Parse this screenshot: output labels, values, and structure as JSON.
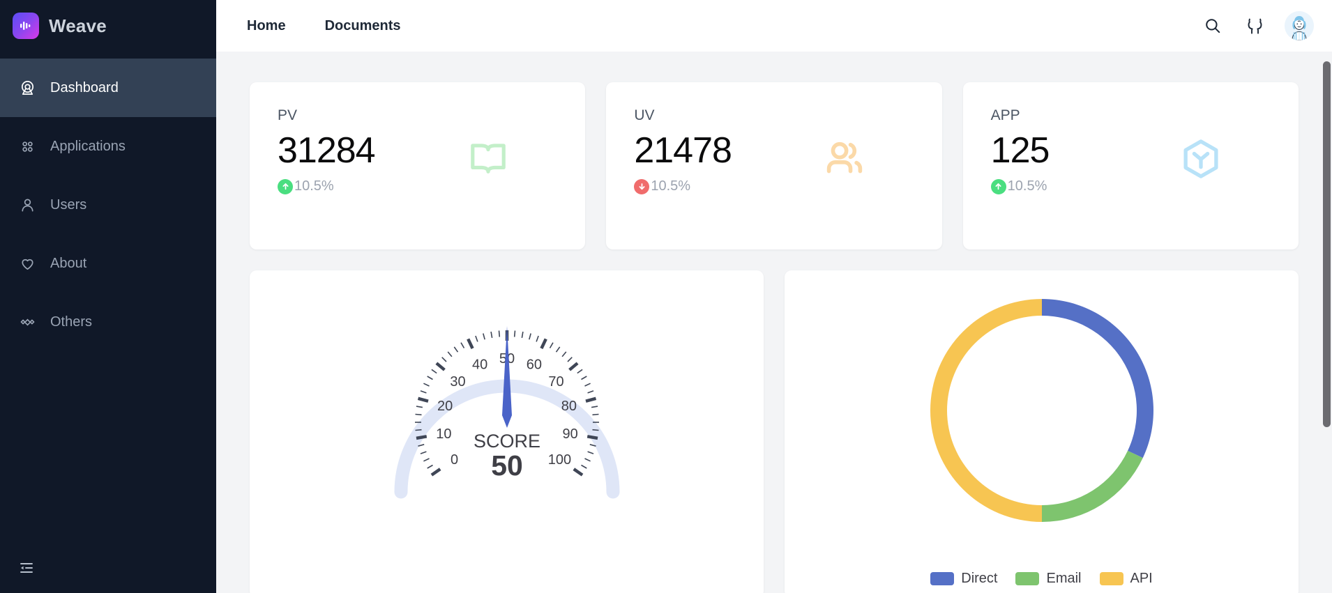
{
  "sidebar": {
    "brand": {
      "name": "Weave",
      "logo_icon": "audio-wave-icon"
    },
    "items": [
      {
        "label": "Dashboard",
        "icon": "dashboard-icon",
        "active": true
      },
      {
        "label": "Applications",
        "icon": "apps-grid-icon",
        "active": false
      },
      {
        "label": "Users",
        "icon": "user-icon",
        "active": false
      },
      {
        "label": "About",
        "icon": "heart-icon",
        "active": false
      },
      {
        "label": "Others",
        "icon": "diamonds-icon",
        "active": false
      }
    ],
    "collapse_icon": "collapse-sidebar-icon",
    "bg_color": "#101828",
    "active_bg_color": "#334155"
  },
  "topbar": {
    "nav": [
      {
        "label": "Home"
      },
      {
        "label": "Documents"
      }
    ],
    "search_icon": "search-icon",
    "github_icon": "github-icon",
    "avatar_icon": "user-avatar"
  },
  "stats": [
    {
      "label": "PV",
      "value": "31284",
      "trend_value": "10.5%",
      "trend_direction": "up",
      "trend_color": "#4ade80",
      "icon": "book-open-icon",
      "icon_color": "#c3efc9"
    },
    {
      "label": "UV",
      "value": "21478",
      "trend_value": "10.5%",
      "trend_direction": "down",
      "trend_color": "#f06c6c",
      "icon": "users-icon",
      "icon_color": "#fbd9a8"
    },
    {
      "label": "APP",
      "value": "125",
      "trend_value": "10.5%",
      "trend_direction": "up",
      "trend_color": "#4ade80",
      "icon": "hexagon-y-icon",
      "icon_color": "#b8e2f8"
    }
  ],
  "chart_data": [
    {
      "type": "gauge",
      "title": "SCORE",
      "value": 50,
      "value_label": "50",
      "min": 0,
      "max": 100,
      "tick_labels": [
        "0",
        "10",
        "20",
        "30",
        "40",
        "50",
        "60",
        "70",
        "80",
        "90",
        "100"
      ],
      "major_tick_step": 10,
      "minor_ticks_per_major": 5,
      "needle_color": "#4a63c8",
      "track_color": "#dfe6f7",
      "tick_color": "#3f4656",
      "title_color": "#3f3f46"
    },
    {
      "type": "pie",
      "subtype": "donut",
      "title": "",
      "categories": [
        "Direct",
        "Email",
        "API"
      ],
      "values": [
        32,
        18,
        50
      ],
      "colors": [
        "#5570c6",
        "#7ec46e",
        "#f6c martin"
      ],
      "legend_position": "bottom",
      "legend": [
        {
          "label": "Direct",
          "color": "#5570c6",
          "value": 32
        },
        {
          "label": "Email",
          "color": "#7ec46e",
          "value": 18
        },
        {
          "label": "API",
          "color": "#f7c552",
          "value": 50
        }
      ]
    }
  ]
}
